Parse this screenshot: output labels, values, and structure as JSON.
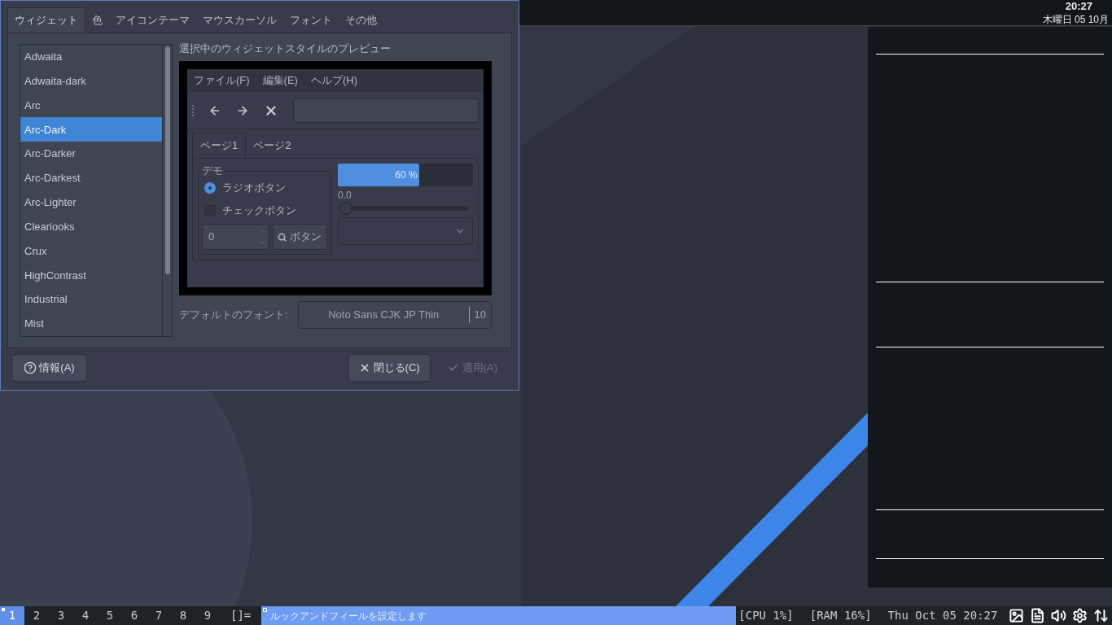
{
  "dialog": {
    "tabs": [
      {
        "label": "ウィジェット",
        "selected": true
      },
      {
        "label": "色",
        "selected": false
      },
      {
        "label": "アイコンテーマ",
        "selected": false
      },
      {
        "label": "マウスカーソル",
        "selected": false
      },
      {
        "label": "フォント",
        "selected": false
      },
      {
        "label": "その他",
        "selected": false
      }
    ],
    "themes": [
      {
        "name": "Adwaita",
        "selected": false
      },
      {
        "name": "Adwaita-dark",
        "selected": false
      },
      {
        "name": "Arc",
        "selected": false
      },
      {
        "name": "Arc-Dark",
        "selected": true
      },
      {
        "name": "Arc-Darker",
        "selected": false
      },
      {
        "name": "Arc-Darkest",
        "selected": false
      },
      {
        "name": "Arc-Lighter",
        "selected": false
      },
      {
        "name": "Clearlooks",
        "selected": false
      },
      {
        "name": "Crux",
        "selected": false
      },
      {
        "name": "HighContrast",
        "selected": false
      },
      {
        "name": "Industrial",
        "selected": false
      },
      {
        "name": "Mist",
        "selected": false
      }
    ],
    "preview_title": "選択中のウィジェットスタイルのプレビュー",
    "preview": {
      "menu": [
        "ファイル(F)",
        "編集(E)",
        "ヘルプ(H)"
      ],
      "tabs": [
        {
          "label": "ページ1",
          "selected": true
        },
        {
          "label": "ページ2",
          "selected": false
        }
      ],
      "group_title": "デモ",
      "radio": {
        "label": "ラジオボタン",
        "checked": true
      },
      "checkbox": {
        "label": "チェックボタン",
        "checked": false
      },
      "spin_value": "0",
      "button": "ボタン",
      "progress": {
        "level": 0.6,
        "text": "60 %"
      },
      "slider": {
        "reading": "0.0",
        "level": 0
      }
    },
    "font_label": "デフォルトのフォント:",
    "font": {
      "name": "Noto Sans CJK JP Thin",
      "size": "10"
    },
    "info_button": "情報(A)",
    "buttons": [
      {
        "kind": "close",
        "label": "閉じる(C)",
        "disabled": false
      },
      {
        "kind": "apply",
        "label": "適用(A)",
        "disabled": true
      }
    ]
  },
  "top_bar": {
    "time": "20:27",
    "date": "木曜日 05 10月"
  },
  "taskbar": {
    "workspaces": [
      {
        "label": "1",
        "selected": true
      },
      {
        "label": "2",
        "selected": false
      },
      {
        "label": "3",
        "selected": false
      },
      {
        "label": "4",
        "selected": false
      },
      {
        "label": "5",
        "selected": false
      },
      {
        "label": "6",
        "selected": false
      },
      {
        "label": "7",
        "selected": false
      },
      {
        "label": "8",
        "selected": false
      },
      {
        "label": "9",
        "selected": false
      }
    ],
    "layout": "[]=",
    "window_title": "ルックアンドフィールを設定します",
    "status": [
      "[CPU 1%]",
      "[RAM 16%]",
      "Thu Oct 05 20:27"
    ]
  }
}
